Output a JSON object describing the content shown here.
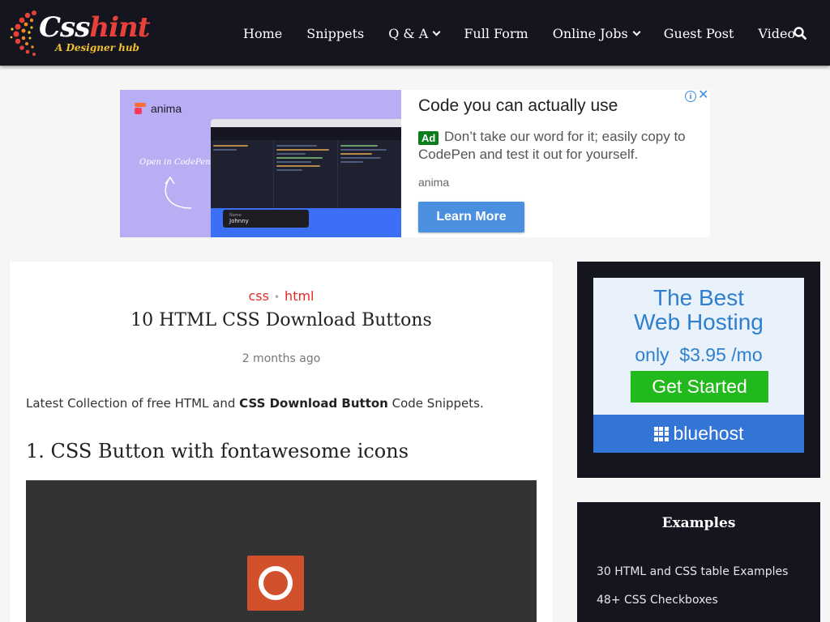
{
  "site": {
    "logo_text_main": "Css",
    "logo_text_highlight": "hint",
    "logo_tagline": "A Designer hub"
  },
  "nav": {
    "items": [
      {
        "label": "Home",
        "has_dropdown": false
      },
      {
        "label": "Snippets",
        "has_dropdown": false
      },
      {
        "label": "Q & A",
        "has_dropdown": true
      },
      {
        "label": "Full Form",
        "has_dropdown": false
      },
      {
        "label": "Online Jobs",
        "has_dropdown": true
      },
      {
        "label": "Guest Post",
        "has_dropdown": false
      },
      {
        "label": "Video",
        "has_dropdown": false
      }
    ],
    "search_icon": "search-icon"
  },
  "top_ad": {
    "brand_logo": "anima",
    "image_caption": "Open in CodePen",
    "preview_label": "Name",
    "preview_value": "Johnny",
    "headline": "Code you can actually use",
    "badge": "Ad",
    "body": "Don’t take our word for it; easily copy to CodePen and test it out for yourself.",
    "advertiser": "anima",
    "cta": "Learn More",
    "info_icon": "i",
    "close_icon": "✕"
  },
  "article": {
    "categories": [
      "css",
      "html"
    ],
    "category_separator": "•",
    "title": "10 HTML CSS Download Buttons",
    "date": "2 months ago",
    "intro_before": "Latest Collection of free HTML and ",
    "intro_bold": "CSS Download Button",
    "intro_after": " Code Snippets.",
    "section_heading": "1. CSS Button with fontawesome icons"
  },
  "sidebar": {
    "hosting_ad": {
      "line1": "The Best",
      "line2": "Web Hosting",
      "price": "only  $3.95 /mo",
      "cta": "Get Started",
      "brand": "bluehost"
    },
    "widget": {
      "title": "Examples",
      "links": [
        "30 HTML and CSS table Examples",
        "48+ CSS Checkboxes"
      ]
    }
  },
  "colors": {
    "header_bg": "#151520",
    "accent_red": "#e02a2a",
    "ad_cta_blue": "#4a8fe0",
    "hosting_green": "#22b91d",
    "hosting_blue": "#3375d6",
    "demo_button": "#d2512d"
  }
}
